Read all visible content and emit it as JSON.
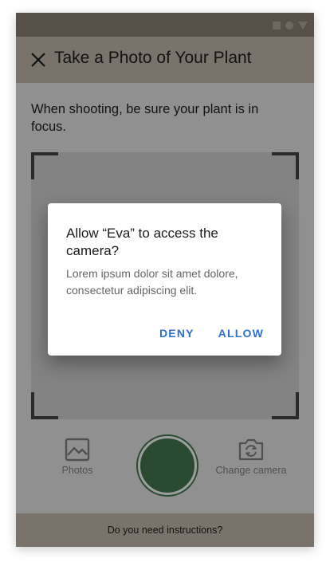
{
  "toolbar": {
    "close_icon": "close-icon",
    "title": "Take a Photo of Your Plant"
  },
  "content": {
    "instruction": "When shooting, be sure your plant is in focus."
  },
  "controls": {
    "photos_label": "Photos",
    "photos_icon": "image-icon",
    "change_camera_label": "Change camera",
    "change_camera_icon": "camera-switch-icon"
  },
  "bottom_bar": {
    "text": "Do you need instructions?"
  },
  "dialog": {
    "title": "Allow “Eva” to access the camera?",
    "body": "Lorem ipsum dolor sit amet dolore, consectetur adipiscing elit.",
    "deny_label": "DENY",
    "allow_label": "ALLOW"
  },
  "colors": {
    "accent": "#2f6fd6",
    "shutter": "#3f6e4a",
    "header": "#b3aa9e",
    "statusbar": "#81776b"
  }
}
